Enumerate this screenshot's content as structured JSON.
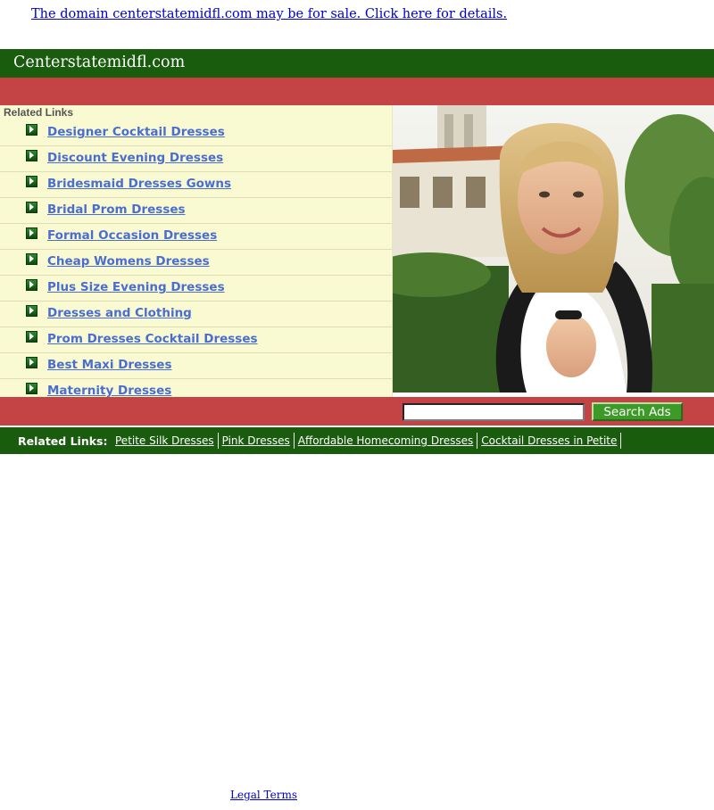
{
  "top_notice": {
    "text": "The domain centerstatemidfl.com may be for sale. Click here for details."
  },
  "header": {
    "site_title": "Centerstatemidfl.com"
  },
  "links_panel": {
    "heading": "Related Links",
    "items": [
      "Designer Cocktail Dresses",
      "Discount Evening Dresses",
      "Bridesmaid Dresses Gowns",
      "Bridal Prom Dresses",
      "Formal Occasion Dresses",
      "Cheap Womens Dresses",
      "Plus Size Evening Dresses",
      "Dresses and Clothing",
      "Prom Dresses Cocktail Dresses",
      "Best Maxi Dresses",
      "Maternity Dresses"
    ]
  },
  "photo": {
    "icon": "smiling-student-photo"
  },
  "search": {
    "value": "",
    "button_label": "Search Ads"
  },
  "related_bar": {
    "label": "Related Links:",
    "items": [
      "Petite Silk Dresses",
      "Pink Dresses",
      "Affordable Homecoming Dresses",
      "Cocktail Dresses in Petite"
    ]
  },
  "footer": {
    "legal_link": "Legal Terms"
  },
  "colors": {
    "header_green": "#1a5c0e",
    "band_red": "#c44345",
    "panel_cream": "#fafad2",
    "link_blue": "#4a6ed0",
    "button_green": "#3e9a28"
  }
}
